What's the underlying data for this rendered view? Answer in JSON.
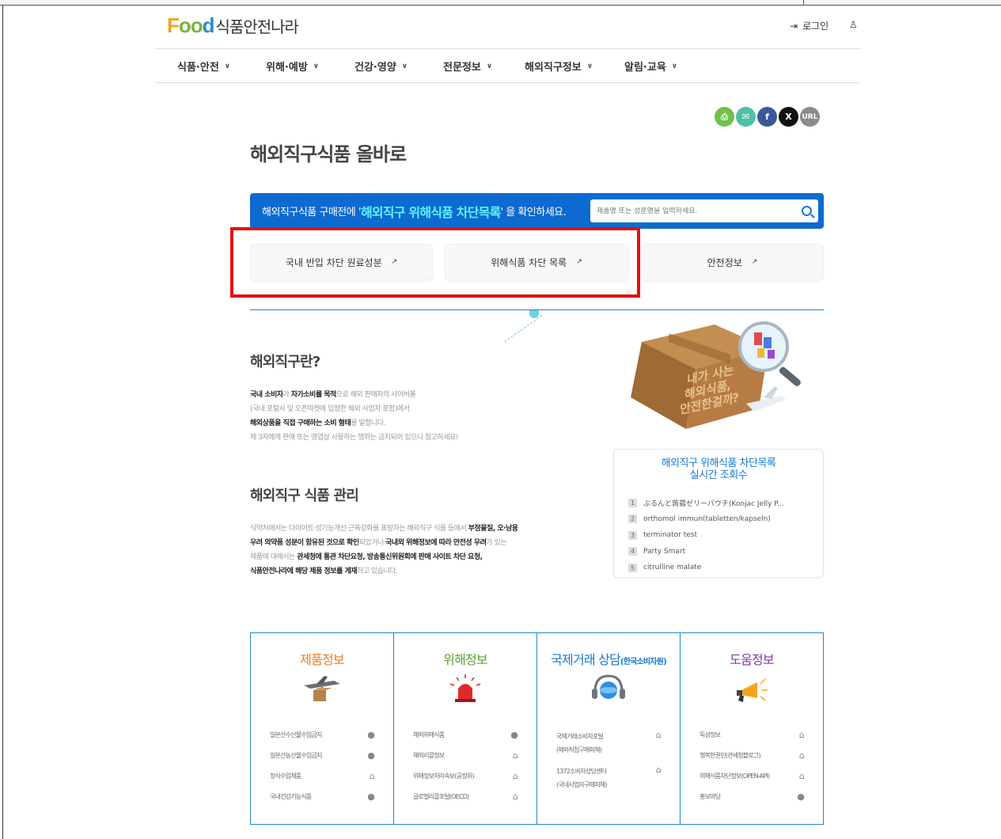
{
  "header": {
    "logo_text": "Food",
    "logo_ko": "식품안전나라",
    "login_label": "로그인"
  },
  "gnb": [
    {
      "label": "식품·안전"
    },
    {
      "label": "위해·예방"
    },
    {
      "label": "건강·영양"
    },
    {
      "label": "전문정보"
    },
    {
      "label": "해외직구정보"
    },
    {
      "label": "알림·교육"
    }
  ],
  "share": [
    {
      "name": "print-icon",
      "color": "#71c04a",
      "glyph": "⎙"
    },
    {
      "name": "email-icon",
      "color": "#4fbfa6",
      "glyph": "✉"
    },
    {
      "name": "facebook-icon",
      "color": "#3b5998",
      "glyph": "f"
    },
    {
      "name": "x-icon",
      "color": "#111111",
      "glyph": "X"
    },
    {
      "name": "url-icon",
      "color": "#8a8a8a",
      "glyph": "URL"
    }
  ],
  "page_title": "해외직구식품 올바로",
  "banner": {
    "text_before": "해외직구식품 구매전에 '",
    "text_highlight": "해외직구 위해식품 차단목록",
    "text_after": "' 을 확인하세요.",
    "search_placeholder": "제품명 또는 성분명을 입력하세요."
  },
  "quick_buttons": [
    {
      "label": "국내 반입 차단 원료성분",
      "arrow": "↗"
    },
    {
      "label": "위해식품 차단 목록",
      "arrow": "↗"
    },
    {
      "label": "안전정보",
      "arrow": "↗"
    }
  ],
  "intro": {
    "title": "해외직구란?",
    "illustration_text": [
      "내가 사는",
      "해외식품,",
      "안전한걸까?"
    ],
    "lines": [
      [
        {
          "t": "국내 소비자",
          "b": true
        },
        {
          "t": "가 ",
          "b": false
        },
        {
          "t": "자가소비를 목적",
          "b": true
        },
        {
          "t": "으로 해외 판매자의 사이버몰",
          "b": false
        }
      ],
      [
        {
          "t": "(국내 포털사 및 오픈마켓에 입점한 해외 사업자 포함)에서",
          "b": false
        }
      ],
      [
        {
          "t": "해외상품을 직접 구매하는 소비 형태",
          "b": true
        },
        {
          "t": "를 말합니다.",
          "b": false
        }
      ],
      [
        {
          "t": "제 3자에게 판매 또는 영업상 사용하는 행위는 금지되어 있으니 참고하세요!",
          "b": false
        }
      ]
    ]
  },
  "manage": {
    "title": "해외직구 식품 관리",
    "lines": [
      [
        {
          "t": "식약처에서는 다이어트·성기능개선·근육강화를 표방하는 해외직구 식품 등에서 ",
          "b": false
        },
        {
          "t": "부정물질, 오·남용",
          "b": true
        }
      ],
      [
        {
          "t": "우려 의약품 성분이 함유된 것으로 확인",
          "b": true
        },
        {
          "t": "되었거나 ",
          "b": false
        },
        {
          "t": "국내외 위해정보에 따라 안전성 우려",
          "b": true
        },
        {
          "t": "가 있는",
          "b": false
        }
      ],
      [
        {
          "t": "제품에 대해서는 ",
          "b": false
        },
        {
          "t": "관세청에 통관 차단요청, 방송통신위원회에 판매 사이트 차단 요청,",
          "b": true
        }
      ],
      [
        {
          "t": "식품안전나라에 해당 제품 정보를 게재",
          "b": true
        },
        {
          "t": "하고 있습니다.",
          "b": false
        }
      ]
    ]
  },
  "realtime": {
    "title_line1": "해외직구 위해식품 차단목록",
    "title_line2": "실시간 조회수",
    "items": [
      {
        "rank": "1",
        "label": "ぷるんと蒟蒻ゼリーパウチ(Konjac Jelly P..."
      },
      {
        "rank": "2",
        "label": "orthomol immun(tabletten/kapseln)"
      },
      {
        "rank": "3",
        "label": "terminator test"
      },
      {
        "rank": "4",
        "label": "Party Smart"
      },
      {
        "rank": "5",
        "label": "citrulline malate"
      }
    ]
  },
  "bottom": [
    {
      "title": "제품정보",
      "title_small": "",
      "color": "#f07a1e",
      "icon": "airplane-box-icon",
      "items": [
        {
          "label": "일본산수산물수입금지",
          "mark": "●"
        },
        {
          "label": "일본산농산물수입금지",
          "mark": "●"
        },
        {
          "label": "정식수입제품",
          "mark": "⌂"
        },
        {
          "label": "국내건강기능식품",
          "mark": "●"
        }
      ]
    },
    {
      "title": "위해정보",
      "title_small": "",
      "color": "#5aa132",
      "icon": "siren-icon",
      "items": [
        {
          "label": "해외위해식품",
          "mark": "●"
        },
        {
          "label": "해외리콜정보",
          "mark": "⌂"
        },
        {
          "label": "위해정보처리속보(공정위)",
          "mark": "⌂"
        },
        {
          "label": "글로벌리콜포털(OECD)",
          "mark": "⌂"
        }
      ]
    },
    {
      "title": "국제거래 상담",
      "title_small": "(한국소비자원)",
      "color": "#1578d4",
      "icon": "headset-icon",
      "items": [
        {
          "label": "국제거래소비자포털\n(해외직접구매피해)",
          "mark": "⌂"
        },
        {
          "label": "1372소비자상담센터\n(국내사업자구매피해)",
          "mark": "⌂"
        }
      ]
    },
    {
      "title": "도움정보",
      "title_small": "",
      "color": "#7c3da6",
      "icon": "megaphone-icon",
      "items": [
        {
          "label": "독성정보",
          "mark": "⌂"
        },
        {
          "label": "행복한권민(관세청블로그)",
          "mark": "⌂"
        },
        {
          "label": "위해식품차단정보(OPEN-API)",
          "mark": "⌂"
        },
        {
          "label": "홍보마당",
          "mark": "●"
        }
      ]
    }
  ]
}
